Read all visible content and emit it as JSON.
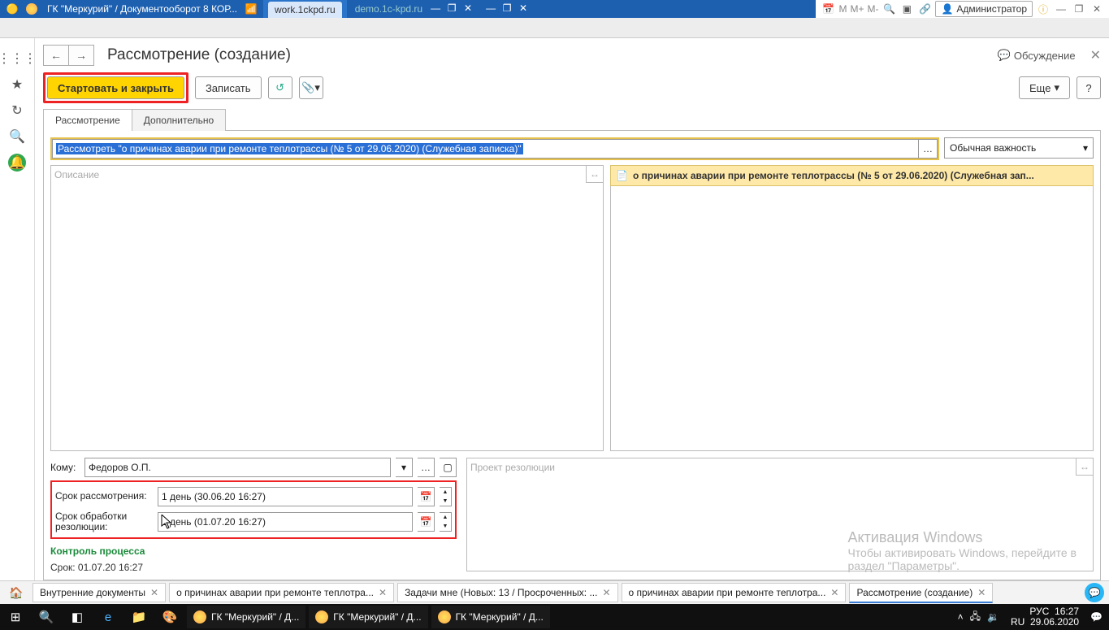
{
  "titlebar": {
    "app_title": "ГК \"Меркурий\" / Документооборот 8 КОР...",
    "center_url": "work.1ckpd.ru",
    "right_url": "demo.1c-kpd.ru",
    "m_labels": [
      "M",
      "M+",
      "M-"
    ],
    "user_label": "Администратор"
  },
  "page": {
    "title": "Рассмотрение (создание)",
    "discuss": "Обсуждение"
  },
  "toolbar": {
    "start_close": "Стартовать и закрыть",
    "write": "Записать",
    "more": "Еще",
    "help": "?"
  },
  "tabs": {
    "t1": "Рассмотрение",
    "t2": "Дополнительно"
  },
  "form": {
    "subject": "Рассмотреть \"о причинах аварии при ремонте теплотрассы (№ 5 от 29.06.2020) (Служебная записка)\"",
    "priority": "Обычная важность",
    "desc_placeholder": "Описание",
    "doc_link": "о причинах аварии при ремонте теплотрассы (№ 5 от 29.06.2020) (Служебная зап...",
    "komu_label": "Кому:",
    "komu_value": "Федоров О.П.",
    "srok_rass_label": "Срок рассмотрения:",
    "srok_rass_value": "1 день (30.06.20 16:27)",
    "srok_obr_label": "Срок обработки резолюции:",
    "srok_obr_value": "1 день (01.07.20 16:27)",
    "kontrol": "Контроль процесса",
    "srok_line": "Срок: 01.07.20 16:27",
    "resol_placeholder": "Проект резолюции"
  },
  "winact": {
    "l1": "Активация Windows",
    "l2": "Чтобы активировать Windows, перейдите в",
    "l3": "раздел \"Параметры\"."
  },
  "doctabs": {
    "t1": "Внутренние документы",
    "t2": "о причинах аварии при ремонте теплотра...",
    "t3": "Задачи мне (Новых: 13 / Просроченных: ...",
    "t4": "о причинах аварии при ремонте теплотра...",
    "t5": "Рассмотрение (создание)"
  },
  "taskbar": {
    "app1": "ГК \"Меркурий\" / Д...",
    "app2": "ГК \"Меркурий\" / Д...",
    "app3": "ГК \"Меркурий\" / Д...",
    "lang1": "РУС",
    "lang2": "RU",
    "time": "16:27",
    "date": "29.06.2020"
  }
}
